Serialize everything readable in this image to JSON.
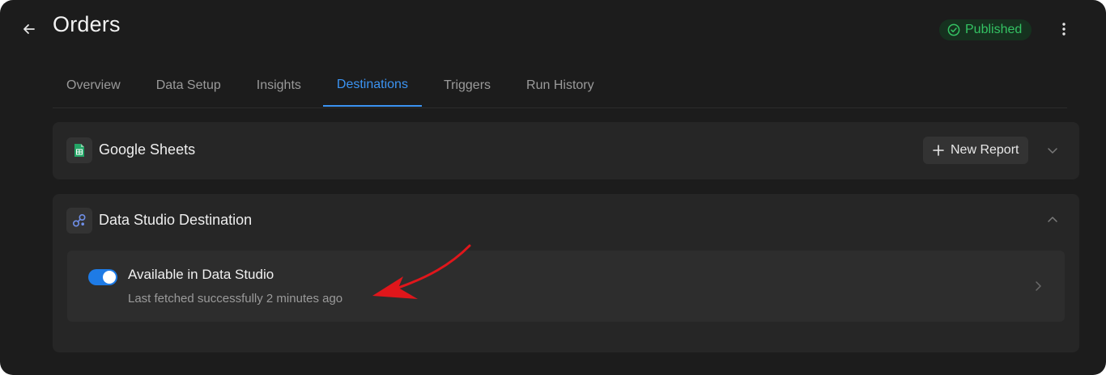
{
  "header": {
    "title": "Orders",
    "status": "Published"
  },
  "tabs": [
    {
      "label": "Overview",
      "active": false
    },
    {
      "label": "Data Setup",
      "active": false
    },
    {
      "label": "Insights",
      "active": false
    },
    {
      "label": "Destinations",
      "active": true
    },
    {
      "label": "Triggers",
      "active": false
    },
    {
      "label": "Run History",
      "active": false
    }
  ],
  "destinations": {
    "sheets": {
      "title": "Google Sheets",
      "icon": "google-sheets-icon",
      "new_report_label": "New Report",
      "expanded": false
    },
    "studio": {
      "title": "Data Studio Destination",
      "icon": "data-studio-icon",
      "expanded": true,
      "row": {
        "title": "Available in Data Studio",
        "subtitle": "Last fetched successfully 2 minutes ago",
        "toggle_on": true
      }
    }
  },
  "colors": {
    "background": "#1c1c1c",
    "card": "#262626",
    "accent": "#3b93f2",
    "success": "#34c263",
    "annotation": "#e0161b"
  }
}
